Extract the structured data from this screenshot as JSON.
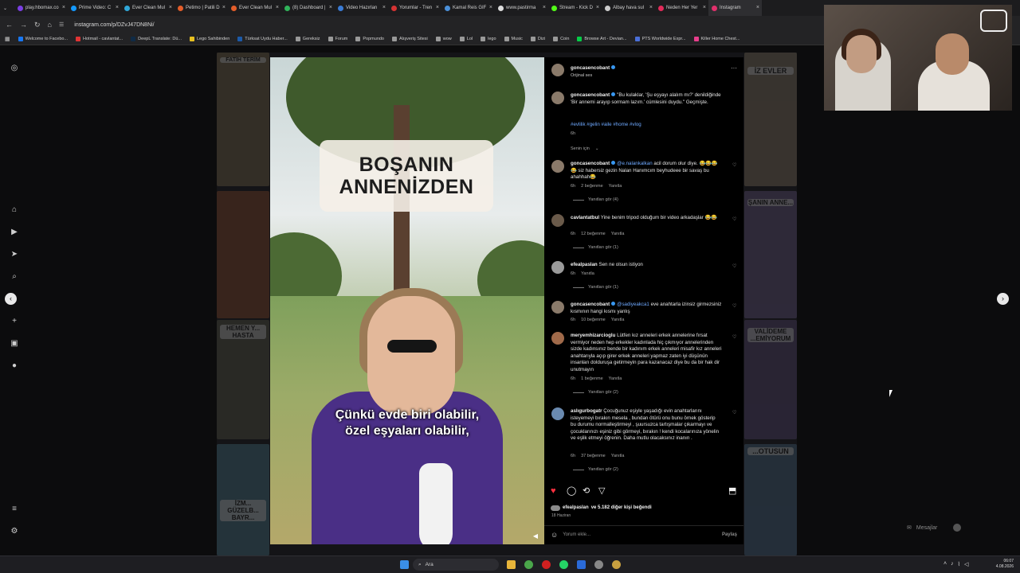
{
  "browser": {
    "tabs": [
      {
        "label": "play.hbomax.co",
        "color": "#7b3fe4"
      },
      {
        "label": "Prime Video: C",
        "color": "#1399ff"
      },
      {
        "label": "Ever Clean Mul",
        "color": "#2fa7d8"
      },
      {
        "label": "Petimo | Patili D",
        "color": "#e35d2a"
      },
      {
        "label": "Ever Clean Mul",
        "color": "#e35d2a"
      },
      {
        "label": "(8) Dashboard |",
        "color": "#30b35a"
      },
      {
        "label": "Video Hazırlan",
        "color": "#3a7bd5"
      },
      {
        "label": "Yorumlar - Tren",
        "color": "#d63333"
      },
      {
        "label": "Kamal Reis GIF",
        "color": "#4a8fd8"
      },
      {
        "label": "www.pastirma",
        "color": "#dddddd"
      },
      {
        "label": "Stream - Kick D",
        "color": "#53fc18"
      },
      {
        "label": "Albay hava sul",
        "color": "#cccccc"
      },
      {
        "label": "Neden Her Yer",
        "color": "#e32b5a"
      },
      {
        "label": "Instagram",
        "color": "#e1306c"
      }
    ],
    "url": "instagram.com/p/DZvJ47DN8Ni/",
    "bookmarks": [
      "Welcome to Facebo...",
      "Hotmail - cavlantat...",
      "DeepL Translate: Dü...",
      "Lego Sahibinden",
      "Türksat Uydu Haber...",
      "Gereksiz",
      "Forum",
      "Popmundo",
      "Alışveriş Sitesi",
      "wow",
      "Lol",
      "lego",
      "Music",
      "Dizi",
      "Coin",
      "Browse Art - Devian...",
      "PTS Worldwide Expr...",
      "Killer Home Chest..."
    ]
  },
  "video": {
    "title_line1": "BOŞANIN",
    "title_line2": "ANNENİZDEN",
    "subtitle_line1": "Çünkü evde biri olabilir,",
    "subtitle_line2": "özel eşyaları olabilir,"
  },
  "background_tiles": {
    "t1": "FATİH TERİM",
    "t2": "HEMEN Y... HASTA",
    "t3": "İZM... GÜZELB... BAYR...",
    "t4": "İZ EVLER",
    "t5": "ŞANIN ANNE...",
    "t6": "VALİDEME ...EMİYORUM",
    "t7": "...OTUSUN"
  },
  "post": {
    "author": "goncasencobant",
    "audio": "Orijinal ses",
    "caption": "\"Bu kulaklar, 'Şu eşyayı alalım mı?' denildiğinde 'Bir annemi arayıp sormam lazım.' cümlesini duydu.\" Geçmişte.",
    "hashtags": "#evlilik #gelin #aile #home #vlog",
    "caption_time": "6h",
    "sort": "Senin için",
    "likes_text": "efealpaslan ve 5.182 diğer kişi beğendi",
    "likes_user": "efealpaslan",
    "likes_rest": " ve 5.182 diğer kişi beğendi",
    "date": "18 Haziran",
    "comment_placeholder": "Yorum ekle...",
    "share_label": "Paylaş"
  },
  "comments": [
    {
      "user": "goncasencobant",
      "mention": "@e.nalankalkan",
      "text": " acil dorum olur diye. 😂😂😂😂 siz habersiz gezin Nalan Hanımcım beyhudeee bir savaş bu ahahhah😂",
      "time": "6h",
      "likes": "2 beğenme",
      "reply": "Yanıtla",
      "view": "Yanıtları gör (4)"
    },
    {
      "user": "cavlantatbul",
      "mention": "",
      "text": " Yine benim tripod olduğum bir video arkadaşlar 😂😂",
      "time": "6h",
      "likes": "12 beğenme",
      "reply": "Yanıtla",
      "view": "Yanıtları gör (1)"
    },
    {
      "user": "efealpaslan",
      "mention": "",
      "text": " Sen ne olsun istiyon",
      "time": "6h",
      "likes": "",
      "reply": "Yanıtla",
      "view": "Yanıtları gör (1)"
    },
    {
      "user": "goncasencobant",
      "mention": "@sadiyeakca1",
      "text": " eve anahtarla izinsiz girmezsiniz kısmının hangi kısmı yanlış",
      "time": "6h",
      "likes": "10 beğenme",
      "reply": "Yanıtla",
      "view": ""
    },
    {
      "user": "meryemhizarcioglu",
      "mention": "",
      "text": " Lütfen kız anneleri erkek annelerine fırsat vermiyor neden hep erkekler kadınlada hiç çıkmıyor annelerinden sizde kadınsınız bende bir kadınım erkek anneleri misafir kız anneleri anahtarıyla açıp girer erkek anneleri yapmaz zaten iyi düşünün insanları dolduruşa getirmeyin para kazanacaz diye bu da bir hak dir unutmayın",
      "time": "6h",
      "likes": "1 beğenme",
      "reply": "Yanıtla",
      "view": "Yanıtları gör (2)"
    },
    {
      "user": "aslıgurbogatr",
      "mention": "",
      "text": " Çocuğunuz eşiyle yaşadığı evin anahtarlarını isteyemeyi bırakın mesela , bundan ötürü onu bunu örnek gösterip bu durumu normalleştirmeyi , şuursuzca tartışmalar çıkarmayı ve çocuklarınızı eşiniz gibi görmeyi, bırakın ! kendi kocalarınıza yönelin ve eşlik etmeyi öğrenin. Daha mutlu olacaksınız inanın .",
      "time": "6h",
      "likes": "37 beğenme",
      "reply": "Yanıtla",
      "view": "Yanıtları gör (2)"
    }
  ],
  "messages_label": "Mesajlar",
  "taskbar": {
    "search_label": "Ara",
    "time": "06:07",
    "date": "4.08.2026"
  }
}
